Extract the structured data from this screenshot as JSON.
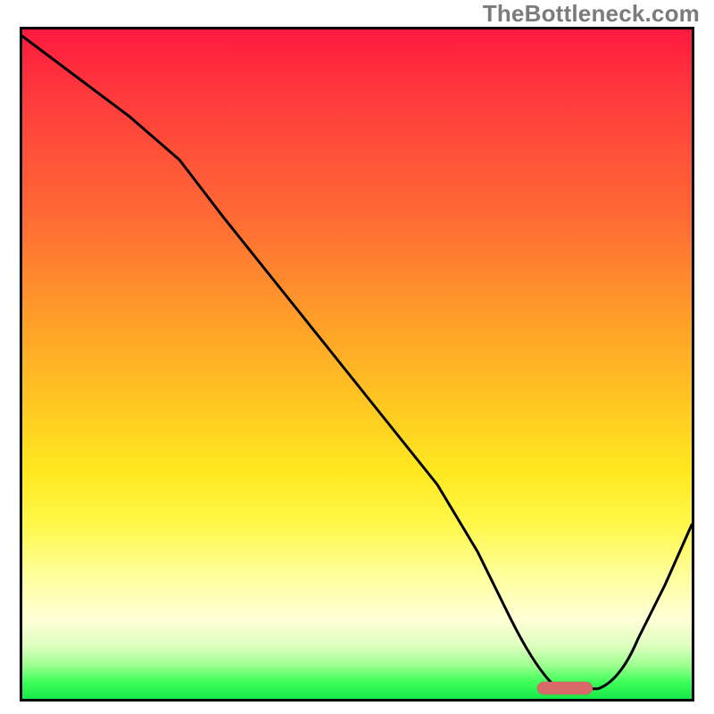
{
  "watermark": "TheBottleneck.com",
  "colors": {
    "gradient_top": "#ff1a3f",
    "gradient_mid": "#ffe81f",
    "gradient_bottom": "#16e84a",
    "curve": "#000000",
    "marker": "#d86a6a",
    "border": "#000000"
  },
  "chart_data": {
    "type": "line",
    "title": "",
    "xlabel": "",
    "ylabel": "",
    "xlim": [
      0,
      100
    ],
    "ylim": [
      0,
      100
    ],
    "grid": false,
    "series": [
      {
        "name": "bottleneck-curve",
        "x": [
          0,
          8,
          16,
          23.5,
          30,
          38,
          46,
          54,
          62,
          68,
          73,
          77,
          80,
          86,
          92,
          96,
          100
        ],
        "y": [
          99,
          93,
          87,
          80.5,
          72,
          62,
          52,
          42,
          32,
          22,
          12,
          4,
          1.5,
          1.5,
          9,
          17,
          26
        ]
      }
    ],
    "annotations": [
      {
        "name": "optimal-marker",
        "shape": "rounded-bar",
        "x_start": 77,
        "x_end": 85,
        "y": 1.5
      }
    ],
    "legend": false
  }
}
